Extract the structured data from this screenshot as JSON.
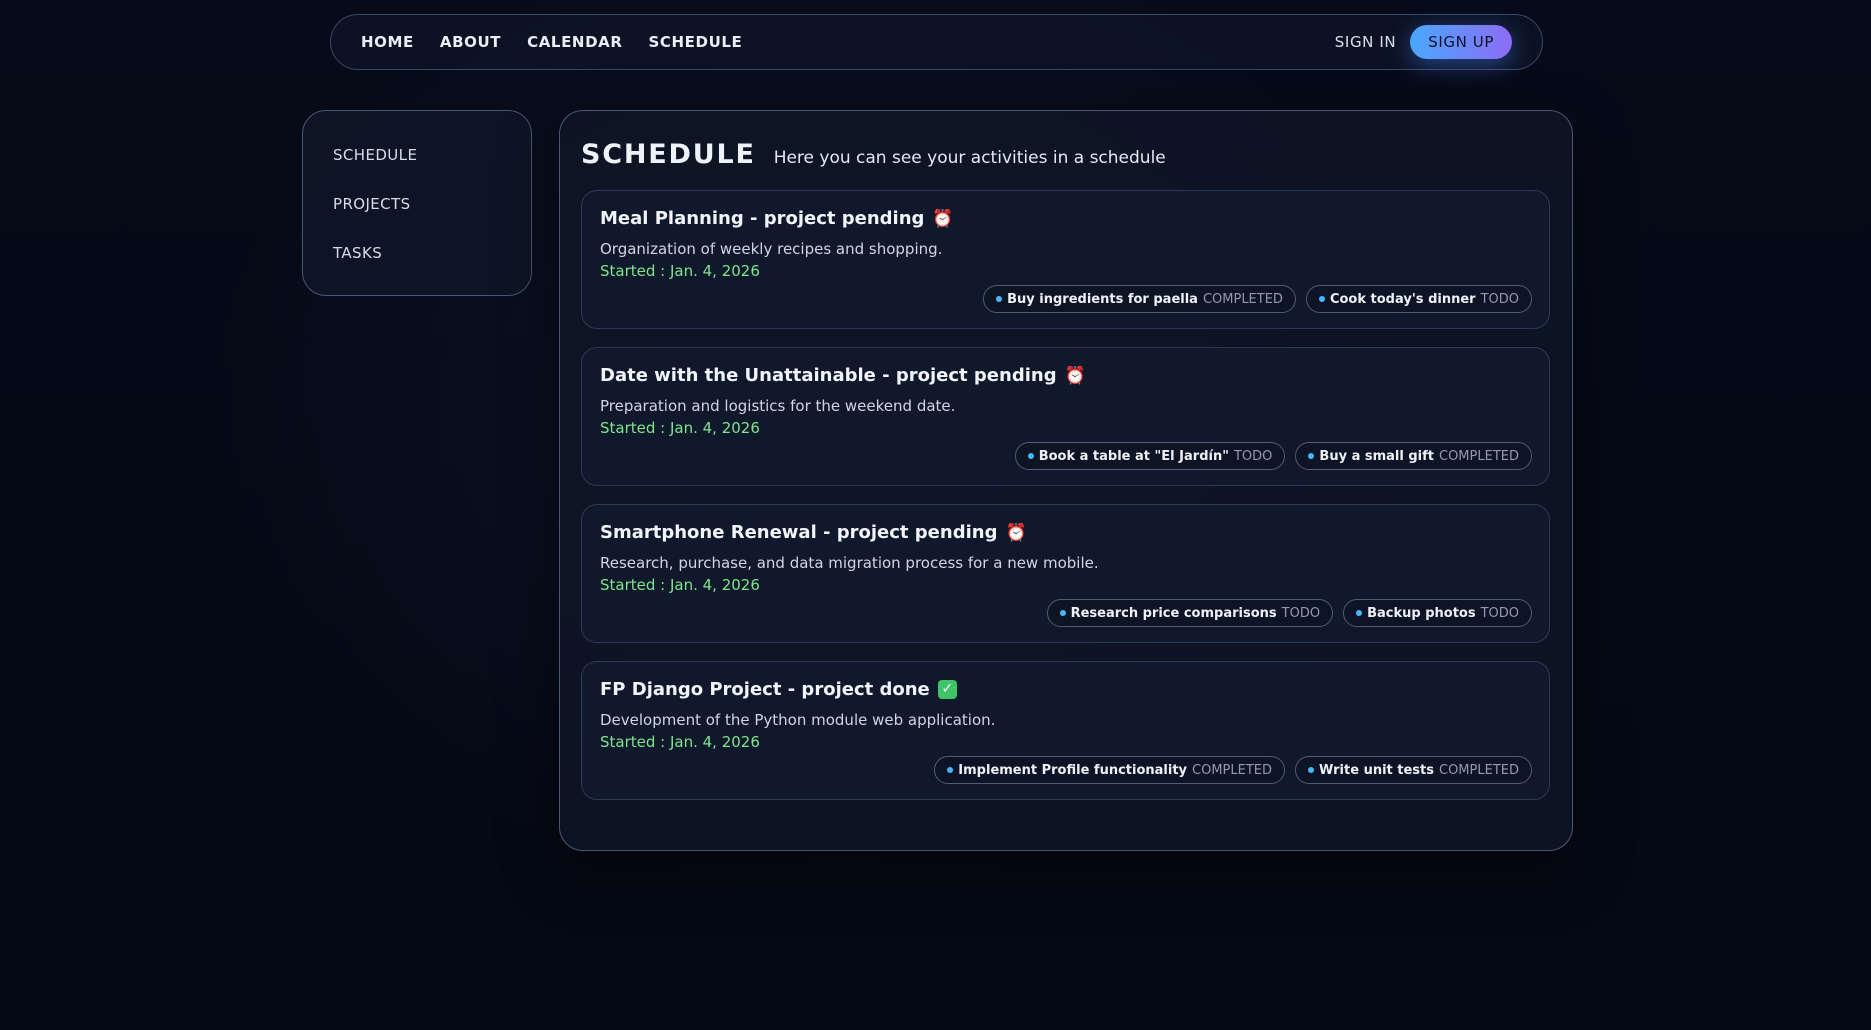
{
  "nav": {
    "links": [
      "HOME",
      "ABOUT",
      "CALENDAR",
      "SCHEDULE"
    ],
    "sign_in": "SIGN IN",
    "sign_up": "SIGN UP"
  },
  "sidebar": {
    "items": [
      "SCHEDULE",
      "PROJECTS",
      "TASKS"
    ]
  },
  "main": {
    "title": "SCHEDULE",
    "subtitle": "Here you can see your activities in a schedule",
    "projects": [
      {
        "title": "Meal Planning - project pending",
        "status_icon": "alarm-clock-icon",
        "description": "Organization of weekly recipes and shopping.",
        "started": "Started : Jan. 4, 2026",
        "tasks": [
          {
            "name": "Buy ingredients for paella",
            "status": "COMPLETED"
          },
          {
            "name": "Cook today's dinner",
            "status": "TODO"
          }
        ]
      },
      {
        "title": "Date with the Unattainable - project pending",
        "status_icon": "alarm-clock-icon",
        "description": "Preparation and logistics for the weekend date.",
        "started": "Started : Jan. 4, 2026",
        "tasks": [
          {
            "name": "Book a table at \"El Jardín\"",
            "status": "TODO"
          },
          {
            "name": "Buy a small gift",
            "status": "COMPLETED"
          }
        ]
      },
      {
        "title": "Smartphone Renewal - project pending",
        "status_icon": "alarm-clock-icon",
        "description": "Research, purchase, and data migration process for a new mobile.",
        "started": "Started : Jan. 4, 2026",
        "tasks": [
          {
            "name": "Research price comparisons",
            "status": "TODO"
          },
          {
            "name": "Backup photos",
            "status": "TODO"
          }
        ]
      },
      {
        "title": "FP Django Project - project done",
        "status_icon": "check-mark-icon",
        "description": "Development of the Python module web application.",
        "started": "Started : Jan. 4, 2026",
        "tasks": [
          {
            "name": "Implement Profile functionality",
            "status": "COMPLETED"
          },
          {
            "name": "Write unit tests",
            "status": "COMPLETED"
          }
        ]
      }
    ]
  },
  "colors": {
    "background": "#060a17",
    "accent_start": "#4aa8ff",
    "accent_end": "#8c6cf5",
    "date_green": "#7ee58d",
    "tag_dot": "#45b8ff"
  }
}
